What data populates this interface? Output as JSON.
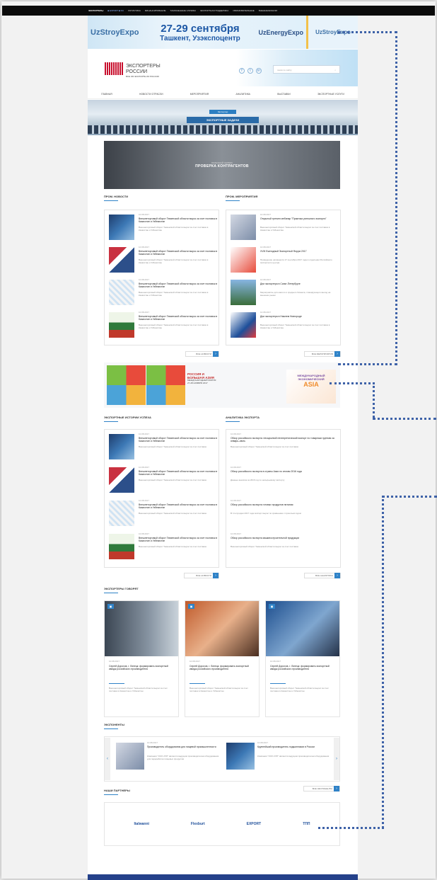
{
  "topbar": {
    "logo": "ЭКСПОРТЕРЫ",
    "lang": "■ EXPORT ■ RU",
    "links": [
      "ЛОГИСТИКА",
      "ФИНАНСИРОВАНИЕ",
      "ТАМОЖЕННЫЕ СЛУЖБЫ",
      "ЭКСПОРТНАЯ ПОДДЕРЖКА",
      "ОБРАЗОВАТЕЛЬНЫЕ",
      "ВНЕШНЕЭКОНОМ"
    ]
  },
  "banner": {
    "left": "UzStroyExpo",
    "date": "27-29 сентября",
    "place": "Ташкент, Узэкспоцентр",
    "energy": "UzEnergyExpo",
    "right": "UzStroyExpo"
  },
  "header": {
    "brand": "ЭКСПОРТЕРЫ",
    "brand2": "РОССИИ",
    "tagline": "ВСЕ ОБ ЭКСПОРТЕ ИЗ РОССИИ",
    "social": [
      "f",
      "t",
      "in"
    ],
    "search_placeholder": "поиск по сайту",
    "search_icon": "⌕"
  },
  "nav": [
    "ГЛАВНАЯ",
    "НОВОСТИ ОТРАСЛИ",
    "МЕРОПРИЯТИЯ",
    "АНАЛИТИКА",
    "ВЫСТАВКИ",
    "ЭКСПОРТНЫЕ УСЛУГИ"
  ],
  "hero": {
    "tag": "Экспортер",
    "title": "ЭКСПОРТНЫЕ ЗАДАЧИ"
  },
  "promo": {
    "sub": "ПОЛЕЗНЫЙ СЕРВИС",
    "title": "ПРОВЕРКА КОНТРАГЕНТОВ"
  },
  "news": {
    "heading": "ПРОМ. НОВОСТИ",
    "items": [
      {
        "date": "10.08.2017",
        "title": "Внешнеторговый оборот Тюменской области вырос за счет поставок в Казахстан и Узбекистан",
        "summary": "Внешнеторговый оборот Тюменской области вырос за счет поставок в Казахстан и Узбекистан"
      },
      {
        "date": "10.08.2017",
        "title": "Внешнеторговый оборот Тюменской области вырос за счет поставок в Казахстан и Узбекистан",
        "summary": "Внешнеторговый оборот Тюменской области вырос за счет поставок в Казахстан и Узбекистан"
      },
      {
        "date": "10.08.2017",
        "title": "Внешнеторговый оборот Тюменской области вырос за счет поставок в Казахстан и Узбекистан",
        "summary": "Внешнеторговый оборот Тюменской области вырос за счет поставок в Казахстан и Узбекистан"
      },
      {
        "date": "10.08.2017",
        "title": "Внешнеторговый оборот Тюменской области вырос за счет поставок в Казахстан и Узбекистан",
        "summary": "Внешнеторговый оборот Тюменской области вырос за счет поставок в Казахстан и Узбекистан"
      }
    ],
    "more": "ВСЕ НОВОСТИ"
  },
  "events": {
    "heading": "ПРОМ. МЕРОПРИЯТИЯ",
    "items": [
      {
        "date": "10.08.2017",
        "title": "Открытый тренинг-вебинар \"Практика успешного экспорта\"",
        "summary": "Внешнеторговый оборот Тюменской области вырос за счет поставок в Казахстан и Узбекистан"
      },
      {
        "date": "10.08.2017",
        "title": "XVIII Ежегодный Экспортный Форум 2017",
        "summary": "Проведение начинается 17 сентября 2017 года в отделении Российского экспортного центра"
      },
      {
        "date": "10.08.2017",
        "title": "Дни экспортера в Санкт-Петербурге",
        "summary": "Мероприятие для малого и среднего бизнеса, планирующего выход на внешние рынки"
      },
      {
        "date": "10.08.2017",
        "title": "Дни экспортера в Нижнем Новгороде",
        "summary": "Внешнеторговый оборот Тюменской области вырос за счет поставок в Казахстан и Узбекистан"
      }
    ],
    "more": "ВСЕ МЕРОПРИЯТИЯ"
  },
  "ad2": {
    "t1": "РОССИЯ И",
    "t2": "БОЛЬШАЯ АЗИЯ",
    "sub": "МЕЖДУНАРОДНЫЙ ФОРУМ",
    "date": "27-28 НОЯБРЯ 2017",
    "right": "МЕЖДУНАРОДНЫЙ ЭКОНОМИЧЕСКИЙ",
    "asia": "ASIA"
  },
  "exporters": {
    "heading": "ЭКСПОРТНЫЕ ИСТОРИИ УСПЕХА",
    "items": [
      {
        "date": "10.08.2017",
        "title": "Внешнеторговый оборот Тюменской области вырос за счет поставок в Казахстан и Узбекистан",
        "summary": "Внешнеторговый оборот Тюменской области вырос за счет поставок"
      },
      {
        "date": "10.08.2017",
        "title": "Внешнеторговый оборот Тюменской области вырос за счет поставок в Казахстан и Узбекистан",
        "summary": "Внешнеторговый оборот Тюменской области вырос за счет поставок"
      },
      {
        "date": "10.08.2017",
        "title": "Внешнеторговый оборот Тюменской области вырос за счет поставок в Казахстан и Узбекистан",
        "summary": "Внешнеторговый оборот Тюменской области вырос за счет поставок"
      },
      {
        "date": "10.08.2017",
        "title": "Внешнеторговый оборот Тюменской области вырос за счет поставок в Казахстан и Узбекистан",
        "summary": "Внешнеторговый оборот Тюменской области вырос за счет поставок"
      }
    ],
    "more": "ВСЕ НОВОСТИ"
  },
  "analytics": {
    "heading": "АНАЛИТИКА ЭКСПОРТА",
    "items": [
      {
        "date": "10.08.2017",
        "title": "Обзор российского экспорта: несырьевой неэнергетический экспорт по товарным группам за январь–июль",
        "summary": "Внешнеторговый оборот Тюменской области вырос за счет поставок"
      },
      {
        "date": "10.08.2017",
        "title": "Обзор российского экспорта в страны Азии по итогам 2016 года",
        "summary": "Данные анализа за 2016 год по несырьевому экспорту"
      },
      {
        "date": "10.08.2017",
        "title": "Обзор российского экспорта готовых продуктов питания",
        "summary": "В I полугодии 2017 года экспорт вырос по сравнению с прошлым годом"
      },
      {
        "date": "10.08.2017",
        "title": "Обзор российского экспорта машиностроительной продукции",
        "summary": "Внешнеторговый оборот Тюменской области вырос за счет поставок"
      }
    ],
    "more": "ВСЕ АНАЛИТИКА"
  },
  "interviews": {
    "heading": "ЭКСПОРТЕРЫ ГОВОРЯТ",
    "cards": [
      {
        "date": "10.08.2017",
        "title": "Сергей Дорохов, г. Липецк: формировать экспортный имидж российского производителя",
        "summary": "Внешнеторговый оборот Тюменской области вырос за счет поставок в Казахстан и Узбекистан"
      },
      {
        "date": "10.08.2017",
        "title": "Сергей Дорохов, г. Липецк: формировать экспортный имидж российского производителя",
        "summary": "Внешнеторговый оборот Тюменской области вырос за счет поставок в Казахстан и Узбекистан"
      },
      {
        "date": "10.08.2017",
        "title": "Сергей Дорохов, г. Липецк: формировать экспортный имидж российского производителя",
        "summary": "Внешнеторговый оборот Тюменской области вырос за счет поставок в Казахстан и Узбекистан"
      }
    ]
  },
  "exhibitions": {
    "heading": "ЭКСПОНЕНТЫ",
    "items": [
      {
        "date": "10.08.2017",
        "title": "Производитель оборудования для пищевой промышленности",
        "summary": "Компания \"ООО АТЛ\" является ведущим производителем оборудования для переработки пищевых продуктов"
      },
      {
        "date": "10.08.2017",
        "title": "Крупнейший производитель подшипников в России",
        "summary": "Компания \"ООО АТЛ\" является ведущим производителем оборудования"
      }
    ],
    "more": "ВСЕ ЭКСПОНЕНТЫ"
  },
  "partners": {
    "heading": "НАШИ ПАРТНЕРЫ",
    "items": [
      "Italwanni",
      "Flexburt",
      "EXPORT",
      "ТПП"
    ]
  }
}
